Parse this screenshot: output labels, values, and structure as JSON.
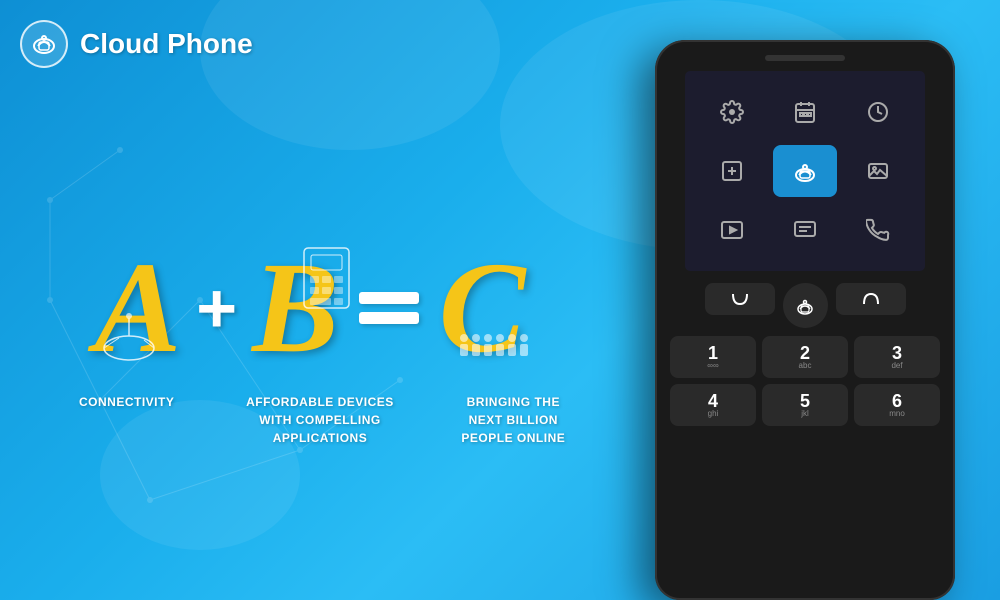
{
  "header": {
    "brand": "Cloud Phone",
    "logo_icon": "☁"
  },
  "formula": {
    "a_label": "A",
    "plus_label": "+",
    "b_label": "B",
    "equals_label": "=",
    "c_label": "C"
  },
  "descriptions": [
    {
      "id": "connectivity",
      "text": "CONNECTIVITY"
    },
    {
      "id": "affordable",
      "text": "AFFORDABLE DEVICES\nWITH COMPELLING\nAPPLICATIONS"
    },
    {
      "id": "bringing",
      "text": "BRINGING THE\nNEXT BILLION\nPEOPLE ONLINE"
    }
  ],
  "phone": {
    "screen_icons": [
      {
        "id": "settings",
        "glyph": "⚙",
        "active": false
      },
      {
        "id": "calendar",
        "glyph": "▦",
        "active": false
      },
      {
        "id": "clock",
        "glyph": "⏰",
        "active": false
      },
      {
        "id": "add",
        "glyph": "⊞",
        "active": false
      },
      {
        "id": "cloud-phone",
        "glyph": "☁",
        "active": true
      },
      {
        "id": "image",
        "glyph": "🖼",
        "active": false
      },
      {
        "id": "play",
        "glyph": "▶",
        "active": false
      },
      {
        "id": "message",
        "glyph": "≡",
        "active": false
      },
      {
        "id": "phone",
        "glyph": "📞",
        "active": false
      }
    ],
    "nav_left": "(",
    "nav_center": "☁",
    "nav_right": ")",
    "numbers": [
      {
        "main": "1",
        "sub": "∞∞"
      },
      {
        "main": "2",
        "sub": "abc"
      },
      {
        "main": "3",
        "sub": "def"
      },
      {
        "main": "4",
        "sub": "ghi"
      },
      {
        "main": "5",
        "sub": "jkl"
      },
      {
        "main": "6",
        "sub": "mno"
      }
    ]
  },
  "colors": {
    "bg_blue": "#1a9ee2",
    "yellow": "#f5c518",
    "dark_phone": "#1a1a1a",
    "screen_bg": "#1c1c2e",
    "active_icon": "#1a8fd1"
  }
}
